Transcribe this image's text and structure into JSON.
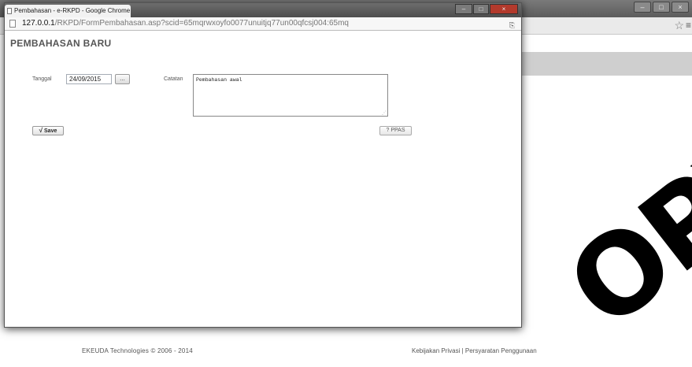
{
  "popup": {
    "tab_title": "Pembahasan - e-RKPD - Google Chrome",
    "url_host": "127.0.0.1",
    "url_path": "/RKPD/FormPembahasan.asp?scid=65mqrwxoyfo0077unuitjq77un00qfcsj004:65mq",
    "page_title": "PEMBAHASAN BARU",
    "form": {
      "tanggal_label": "Tanggal",
      "tanggal_value": "24/09/2015",
      "datepicker_label": "...",
      "catatan_label": "Catatan",
      "catatan_value": "Pembahasan awal",
      "save_label": "Save",
      "ppas_label": "? PPAS"
    }
  },
  "footer": {
    "copyright": "EKEUDA Technologies © 2006 - 2014",
    "privacy_link": "Kebijakan Privasi",
    "separator": "|",
    "terms_link": "Persyaratan Penggunaan"
  },
  "watermark": "OPY",
  "icons": {
    "save": "check-icon",
    "popup_page": "page-icon",
    "bg_star": "star-icon",
    "bg_menu": "menu-icon"
  }
}
